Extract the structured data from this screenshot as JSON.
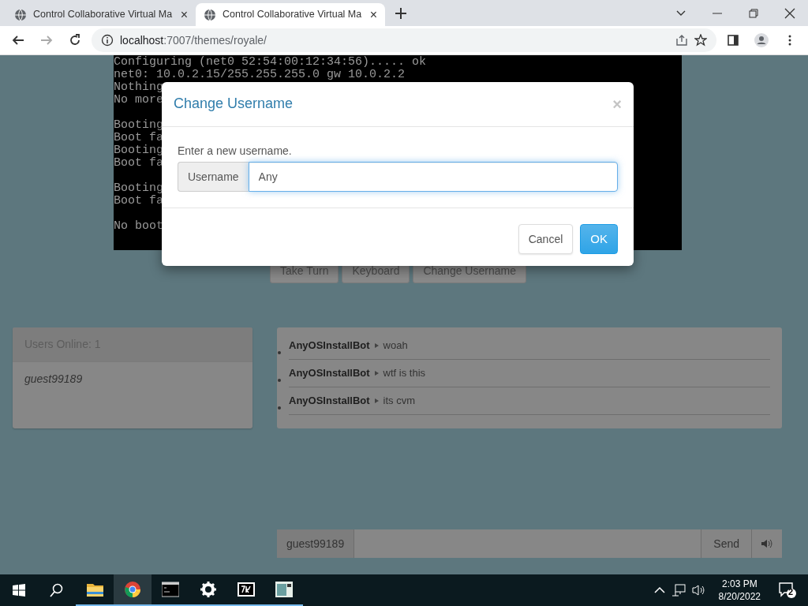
{
  "browser": {
    "tabs": [
      {
        "title": "Control Collaborative Virtual Ma",
        "close": "×",
        "selected": false
      },
      {
        "title": "Control Collaborative Virtual Ma",
        "close": "×",
        "selected": true
      }
    ],
    "url_host": "localhost",
    "url_path": ":7007/themes/royale/"
  },
  "terminal": {
    "blocks": [
      [
        "Configuring (net0 52:54:00:12:34:56)..... ok",
        "net0: 10.0.2.15/255.255.255.0 gw 10.0.2.2",
        "Nothing",
        "No more"
      ],
      [
        "Booting",
        "Boot fa",
        "Booting",
        "Boot fa"
      ],
      [
        "Booting",
        "Boot fa"
      ],
      [
        "No boot"
      ]
    ]
  },
  "vm_buttons": [
    "Take Turn",
    "Keyboard",
    "Change Username"
  ],
  "users": {
    "header": "Users Online: 1",
    "list": [
      "guest99189"
    ]
  },
  "chat": {
    "messages": [
      {
        "user": "AnyOSInstallBot",
        "text": "woah"
      },
      {
        "user": "AnyOSInstallBot",
        "text": "wtf is this"
      },
      {
        "user": "AnyOSInstallBot",
        "text": "its cvm"
      }
    ],
    "username": "guest99189",
    "send": "Send"
  },
  "modal": {
    "title": "Change Username",
    "close": "×",
    "prompt": "Enter a new username.",
    "addon": "Username",
    "value": "Any",
    "cancel": "Cancel",
    "ok": "OK"
  },
  "taskbar": {
    "apps": [
      {
        "kind": "folder",
        "running": true,
        "active": false
      },
      {
        "kind": "chrome",
        "running": true,
        "active": true
      },
      {
        "kind": "terminal",
        "running": true,
        "active": false
      },
      {
        "kind": "settings",
        "running": true,
        "active": false
      },
      {
        "kind": "archiver",
        "running": true,
        "active": false
      },
      {
        "kind": "window",
        "running": true,
        "active": false
      }
    ],
    "time": "2:03 PM",
    "date": "8/20/2022",
    "notifications": "2"
  }
}
